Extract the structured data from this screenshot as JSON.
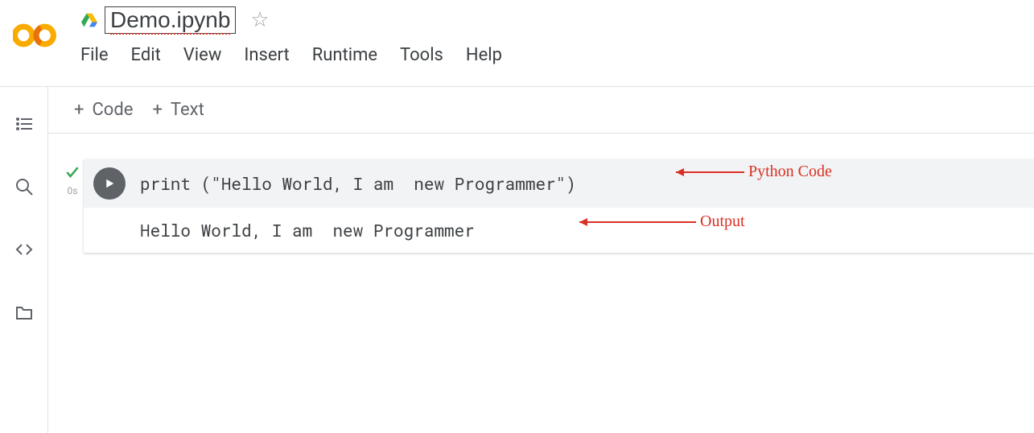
{
  "header": {
    "filename": "Demo.ipynb",
    "menu": {
      "file": "File",
      "edit": "Edit",
      "view": "View",
      "insert": "Insert",
      "runtime": "Runtime",
      "tools": "Tools",
      "help": "Help"
    }
  },
  "toolbar": {
    "code": "Code",
    "text": "Text"
  },
  "cell": {
    "exec_time": "0s",
    "code": "print (\"Hello World, I am  new Programmer\")",
    "output": "Hello World, I am  new Programmer"
  },
  "annotations": {
    "code_label": "Python Code",
    "output_label": "Output"
  }
}
